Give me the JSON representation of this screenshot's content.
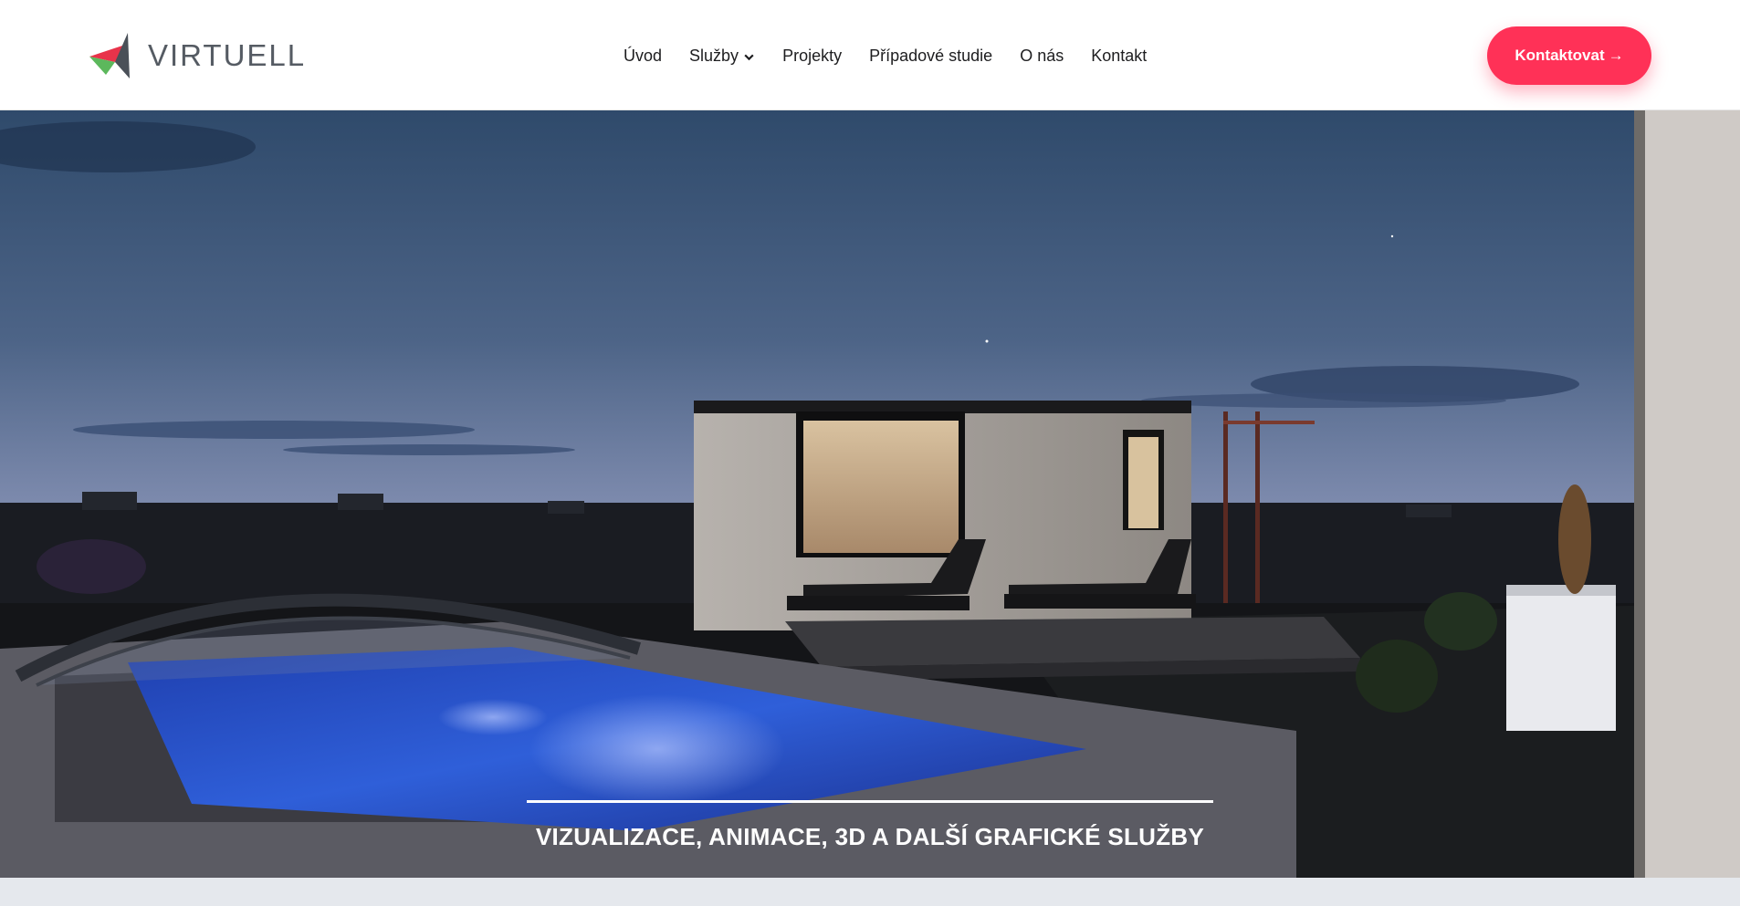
{
  "brand": {
    "name": "VIRTUELL",
    "colors": {
      "accent": "#ff3157",
      "logo_red": "#e8334a",
      "logo_green": "#5cb85c",
      "logo_dark": "#4a5058",
      "text": "#1d1d1f"
    }
  },
  "nav": {
    "items": [
      {
        "label": "Úvod"
      },
      {
        "label": "Služby",
        "icon": "chevron-down-icon"
      },
      {
        "label": "Projekty"
      },
      {
        "label": "Případové studie"
      },
      {
        "label": "O nás"
      },
      {
        "label": "Kontakt"
      }
    ]
  },
  "cta": {
    "label": "Kontaktovat",
    "icon": "arrow-right-icon"
  },
  "hero": {
    "heading": "VIZUALIZACE, ANIMACE, 3D A DALŠÍ GRAFICKÉ SLUŽBY",
    "image": "night-render-pool-garden-house"
  }
}
